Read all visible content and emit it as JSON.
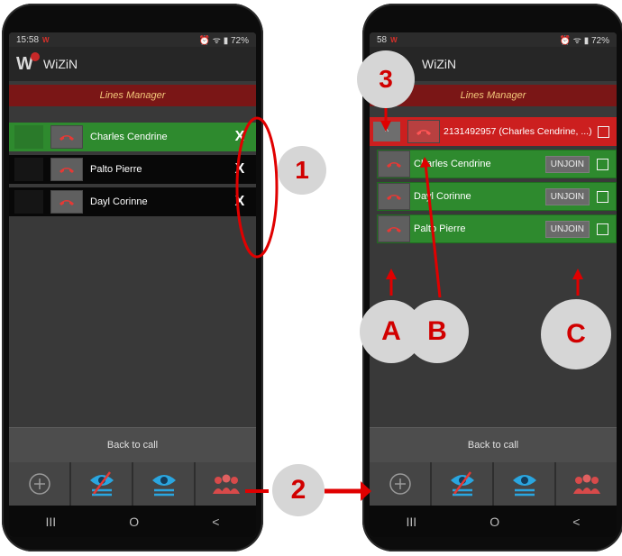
{
  "status": {
    "time": "15:58",
    "carrier_mark": "W",
    "battery": "72%"
  },
  "app": {
    "name": "WiZiN"
  },
  "screen": {
    "title": "Lines Manager"
  },
  "left_phone": {
    "rows": [
      {
        "name": "Charles Cendrine",
        "state": "green"
      },
      {
        "name": "Palto Pierre",
        "state": "black"
      },
      {
        "name": "Dayl Corinne",
        "state": "black"
      }
    ],
    "close_glyph": "X"
  },
  "right_phone": {
    "status_time_partial": "58",
    "conference": {
      "number": "2131492957 (Charles Cendrine, ...)",
      "chevron": "^"
    },
    "members": [
      {
        "name": "Charles Cendrine",
        "action": "UNJOIN"
      },
      {
        "name": "Dayl Corinne",
        "action": "UNJOIN"
      },
      {
        "name": "Palto Pierre",
        "action": "UNJOIN"
      }
    ]
  },
  "footer": {
    "back_to_call": "Back to call"
  },
  "nav": {
    "recents": "III",
    "home": "O",
    "back": "<"
  },
  "callouts": {
    "one": "1",
    "two": "2",
    "three": "3",
    "a": "A",
    "b": "B",
    "c": "C"
  },
  "colors": {
    "accent_red": "#d10000",
    "active_green": "#2e8a2e",
    "conference_red": "#cc1f1f",
    "title_bar": "#7a1616"
  }
}
